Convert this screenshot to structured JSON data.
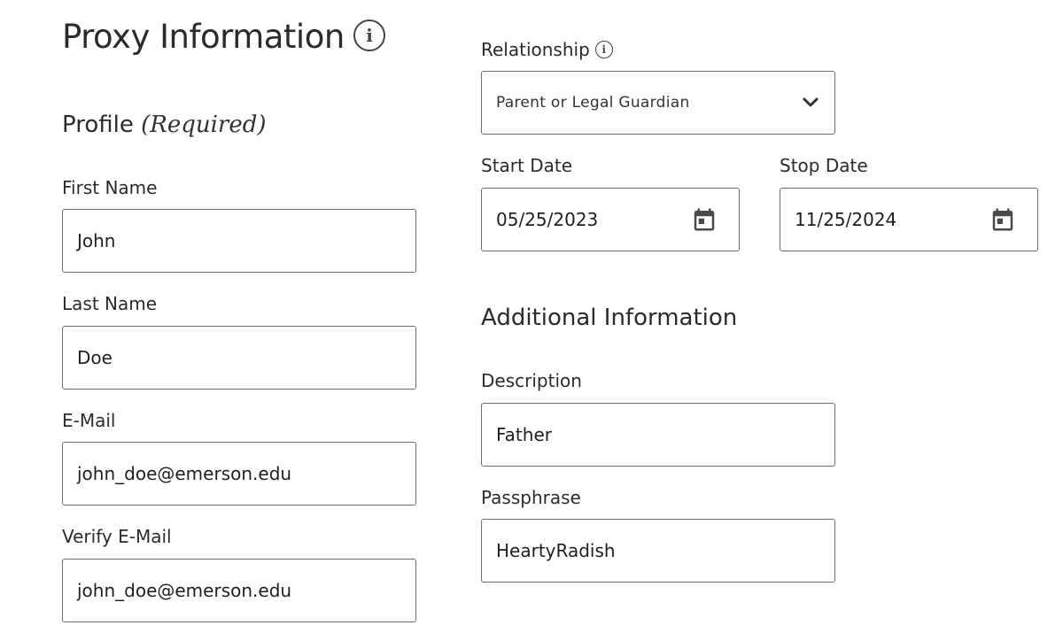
{
  "header": {
    "title": "Proxy Information"
  },
  "profile": {
    "title": "Profile",
    "required_text": "(Required)",
    "first_name": {
      "label": "First Name",
      "value": "John"
    },
    "last_name": {
      "label": "Last Name",
      "value": "Doe"
    },
    "email": {
      "label": "E-Mail",
      "value": "john_doe@emerson.edu"
    },
    "verify_email": {
      "label": "Verify E-Mail",
      "value": "john_doe@emerson.edu"
    }
  },
  "relationship": {
    "label": "Relationship",
    "selected": "Parent or Legal Guardian"
  },
  "dates": {
    "start": {
      "label": "Start Date",
      "value": "05/25/2023"
    },
    "stop": {
      "label": "Stop Date",
      "value": "11/25/2024"
    }
  },
  "additional": {
    "title": "Additional Information",
    "description": {
      "label": "Description",
      "value": "Father"
    },
    "passphrase": {
      "label": "Passphrase",
      "value": "HeartyRadish"
    }
  },
  "icons": {
    "info": "info-icon",
    "dropdown": "chevron-down-icon",
    "calendar": "calendar-icon"
  },
  "colors": {
    "text": "#2b2b2b",
    "border": "#6d6d6d",
    "background": "#ffffff"
  }
}
